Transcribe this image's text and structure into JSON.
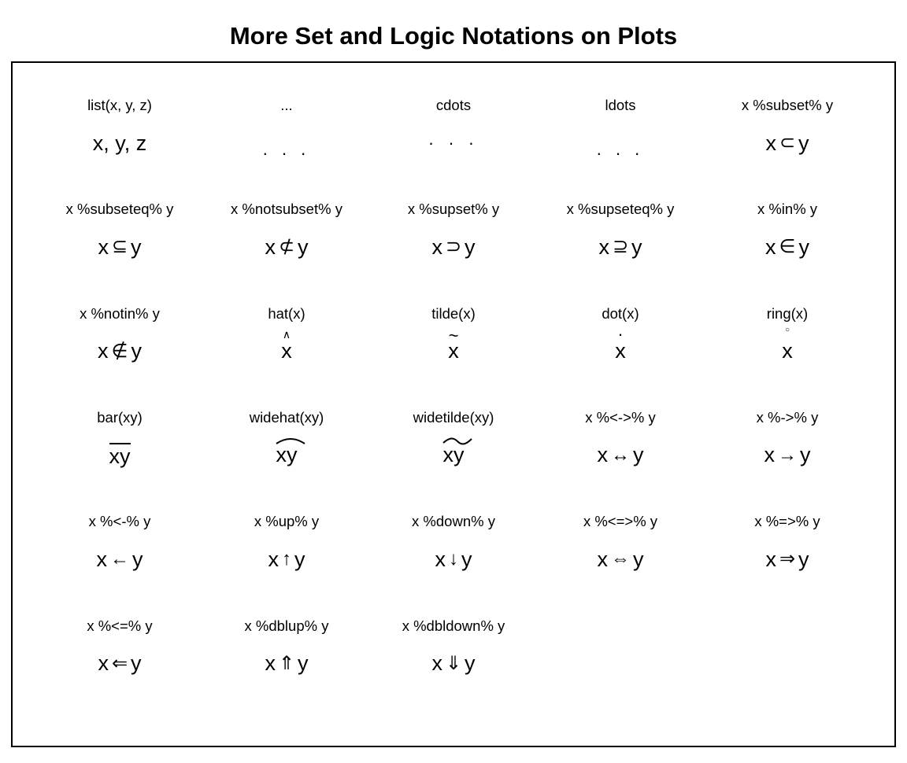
{
  "title": "More Set and Logic Notations on Plots",
  "cells": [
    {
      "label": "list(x, y, z)",
      "kind": "text",
      "l": "x, y, z"
    },
    {
      "label": "...",
      "kind": "ldots"
    },
    {
      "label": "cdots",
      "kind": "cdots"
    },
    {
      "label": "ldots",
      "kind": "ldots"
    },
    {
      "label": "x %subset% y",
      "kind": "xy",
      "op": "⊂"
    },
    {
      "label": "x %subseteq% y",
      "kind": "xy",
      "op": "⊆"
    },
    {
      "label": "x %notsubset% y",
      "kind": "xy",
      "op": "⊄"
    },
    {
      "label": "x %supset% y",
      "kind": "xy",
      "op": "⊃"
    },
    {
      "label": "x %supseteq% y",
      "kind": "xy",
      "op": "⊇"
    },
    {
      "label": "x %in% y",
      "kind": "xy",
      "op": "∈"
    },
    {
      "label": "x %notin% y",
      "kind": "xy",
      "op": "∉"
    },
    {
      "label": "hat(x)",
      "kind": "accent",
      "base": "x",
      "acc": "hat",
      "accChar": "∧"
    },
    {
      "label": "tilde(x)",
      "kind": "accent",
      "base": "x",
      "acc": "tilde",
      "accChar": "~"
    },
    {
      "label": "dot(x)",
      "kind": "accent",
      "base": "x",
      "acc": "dot",
      "accChar": "·"
    },
    {
      "label": "ring(x)",
      "kind": "accent",
      "base": "x",
      "acc": "ring",
      "accChar": "○"
    },
    {
      "label": "bar(xy)",
      "kind": "bar",
      "base": "xy"
    },
    {
      "label": "widehat(xy)",
      "kind": "widehat",
      "base": "xy"
    },
    {
      "label": "widetilde(xy)",
      "kind": "widetilde",
      "base": "xy"
    },
    {
      "label": "x %<->% y",
      "kind": "xy",
      "op": "↔"
    },
    {
      "label": "x %->% y",
      "kind": "xy",
      "op": "→"
    },
    {
      "label": "x %<-% y",
      "kind": "xy",
      "op": "←"
    },
    {
      "label": "x %up% y",
      "kind": "xy",
      "op": "↑"
    },
    {
      "label": "x %down% y",
      "kind": "xy",
      "op": "↓"
    },
    {
      "label": "x %<=>% y",
      "kind": "xy",
      "op": "⇔"
    },
    {
      "label": "x %=>% y",
      "kind": "xy",
      "op": "⇒"
    },
    {
      "label": "x %<=% y",
      "kind": "xy",
      "op": "⇐"
    },
    {
      "label": "x %dblup% y",
      "kind": "xy",
      "op": "⇑"
    },
    {
      "label": "x %dbldown% y",
      "kind": "xy",
      "op": "⇓"
    },
    {
      "label": "",
      "kind": "empty"
    },
    {
      "label": "",
      "kind": "empty"
    }
  ]
}
